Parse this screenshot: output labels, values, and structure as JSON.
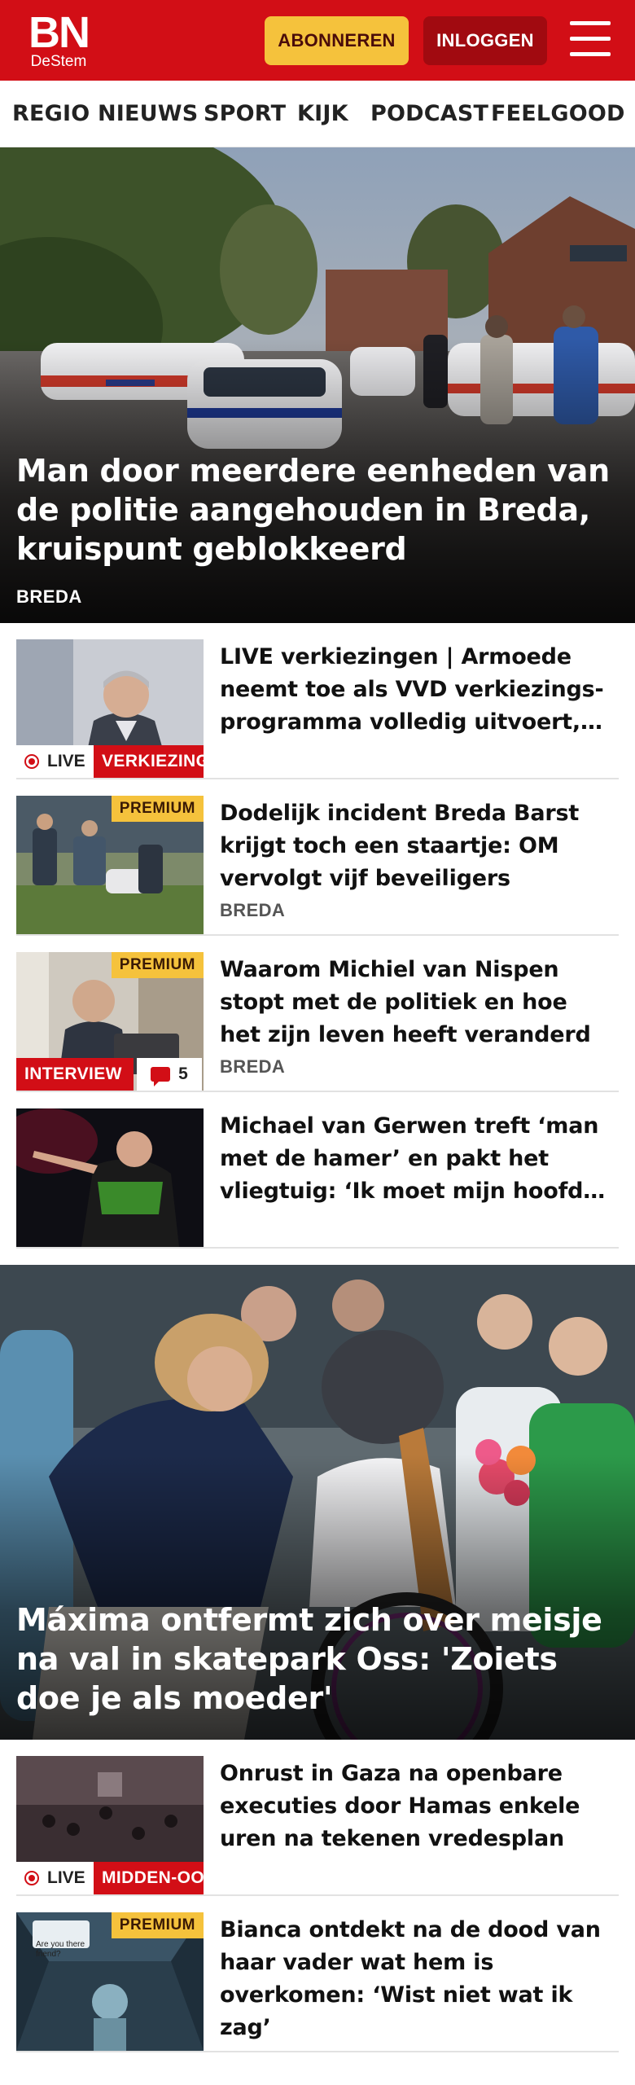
{
  "header": {
    "logo_text": "BN",
    "logo_subtext": "DeStem",
    "subscribe_label": "ABONNEREN",
    "login_label": "INLOGGEN",
    "menu_icon": "hamburger-icon",
    "background_color": "#d20e16"
  },
  "nav": {
    "items": [
      {
        "label": "REGIO"
      },
      {
        "label": "NIEUWS"
      },
      {
        "label": "SPORT"
      },
      {
        "label": "KIJK"
      },
      {
        "label": "PODCAST"
      },
      {
        "label": "FEELGOOD"
      }
    ]
  },
  "hero1": {
    "title": "Man door meerdere eenheden van de politie aangehouden in Breda, kruispunt geblokkeerd",
    "tag": "BREDA"
  },
  "articles1": [
    {
      "title": "LIVE verkiezingen | Armoede neemt toe als VVD verkiezings-programma volledig uitvoert, blijkt uit doorrekening",
      "live_label": "LIVE",
      "category_label": "VERKIEZINGEN"
    },
    {
      "title": "Dodelijk incident Breda Barst krijgt toch een staartje: OM vervolgt vijf beveiligers",
      "premium_label": "PREMIUM",
      "tag": "BREDA"
    },
    {
      "title": "Waarom Michiel van Nispen stopt met de politiek en hoe het zijn leven heeft veranderd",
      "premium_label": "PREMIUM",
      "category_label": "INTERVIEW",
      "comment_count": "5",
      "tag": "BREDA"
    },
    {
      "title": "Michael van Gerwen treft ‘man met de hamer’ en pakt het vliegtuig: ‘Ik moet mijn hoofd leegmaken’"
    }
  ],
  "hero2": {
    "title": "Máxima ontfermt zich over meisje na val in skatepark Oss: 'Zoiets doe je als moeder'"
  },
  "articles2": [
    {
      "title": "Onrust in Gaza na openbare executies door Hamas enkele uren na tekenen vredesplan",
      "live_label": "LIVE",
      "category_label": "MIDDEN-OOSTEN"
    },
    {
      "title": "Bianca ontdekt na de dood van haar vader wat hem is overkomen: ‘Wist niet wat ik zag’",
      "premium_label": "PREMIUM",
      "image_caption": "Are you there friend?"
    }
  ],
  "colors": {
    "brand_red": "#d20e16",
    "premium_yellow": "#f5c23c",
    "login_dark_red": "#a10a10"
  }
}
